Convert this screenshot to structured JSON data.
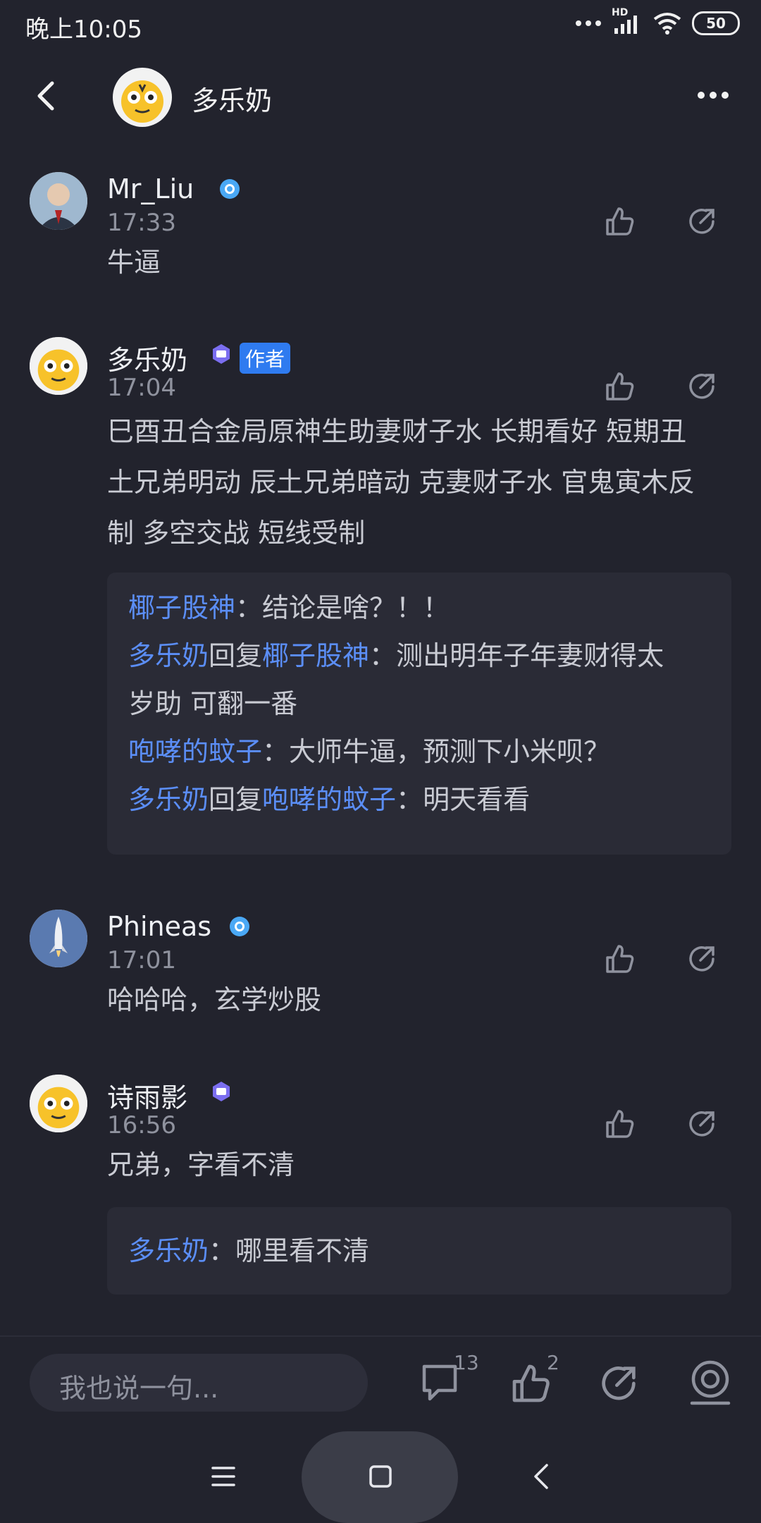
{
  "status": {
    "time": "晚上10:05",
    "network": "HD",
    "battery": "50"
  },
  "header": {
    "title": "多乐奶"
  },
  "comments": [
    {
      "name": "Mr_Liu",
      "time": "17:33",
      "text": "牛逼"
    },
    {
      "name": "多乐奶",
      "author_tag": "作者",
      "time": "17:04",
      "text_lines": [
        "巳酉丑合金局原神生助妻财子水 长期看好 短期丑",
        "土兄弟明动 辰土兄弟暗动 克妻财子水 官鬼寅木反",
        "制 多空交战 短线受制"
      ],
      "replies": [
        {
          "user": "椰子股神",
          "sep": "：",
          "text": "结论是啥？！！"
        },
        {
          "user": "多乐奶",
          "reply_word": "回复",
          "target": "椰子股神",
          "sep": "：",
          "text": "测出明年子年妻财得太",
          "cont": "岁助 可翻一番"
        },
        {
          "user": "咆哮的蚊子",
          "sep": "：",
          "text": "大师牛逼，预测下小米呗？"
        },
        {
          "user": "多乐奶",
          "reply_word": "回复",
          "target": "咆哮的蚊子",
          "sep": "：",
          "text": "明天看看"
        }
      ]
    },
    {
      "name": "Phineas",
      "time": "17:01",
      "text": "哈哈哈，玄学炒股"
    },
    {
      "name": "诗雨影",
      "time": "16:56",
      "text": "兄弟，字看不清",
      "replies": [
        {
          "user": "多乐奶",
          "sep": "：",
          "text": "哪里看不清"
        }
      ]
    }
  ],
  "bottom": {
    "input_placeholder": "我也说一句...",
    "comment_count": "13",
    "like_count": "2"
  },
  "icons": {
    "back": "back-arrow-icon",
    "more": "more-dots-icon",
    "like": "thumbs-up-icon",
    "share": "share-icon",
    "comment": "comment-icon",
    "favorite": "favorite-icon",
    "verified": "verified-badge-icon",
    "member": "member-badge-icon"
  }
}
